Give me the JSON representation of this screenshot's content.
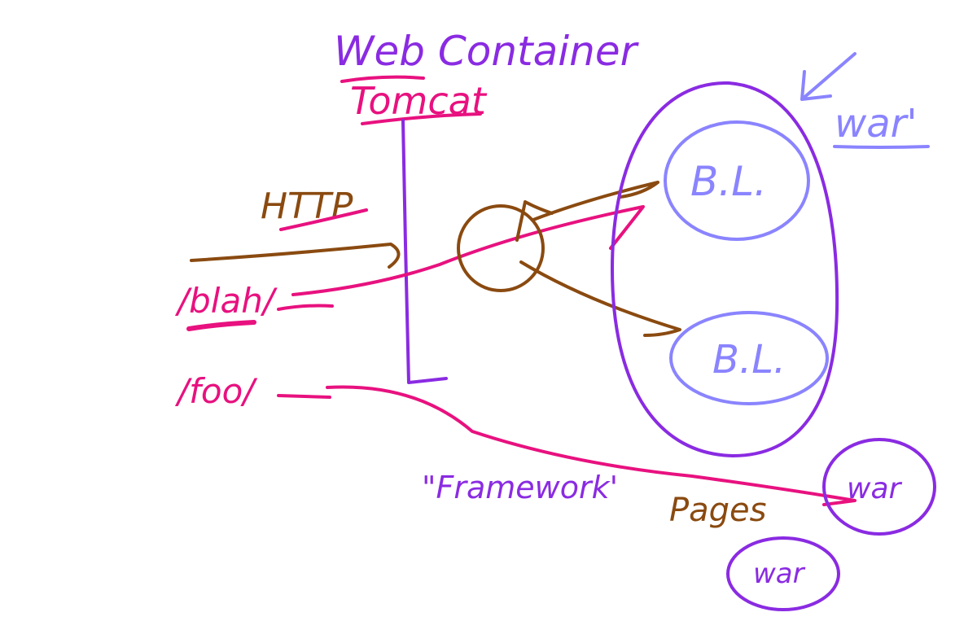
{
  "colors": {
    "purple": "#8a2be2",
    "light_purple": "#8a84ff",
    "brown": "#8a4a10",
    "pink": "#e8117f"
  },
  "labels": {
    "web_container": "Web Container",
    "tomcat": "Tomcat",
    "http": "HTTP",
    "blah": "/blah/",
    "foo": "/foo/",
    "war_quoted": "war'",
    "bl_top": "B.L.",
    "bl_bottom": "B.L.",
    "framework": "\"Framework'",
    "pages": "Pages",
    "war_right": "war",
    "war_bottom": "war"
  }
}
